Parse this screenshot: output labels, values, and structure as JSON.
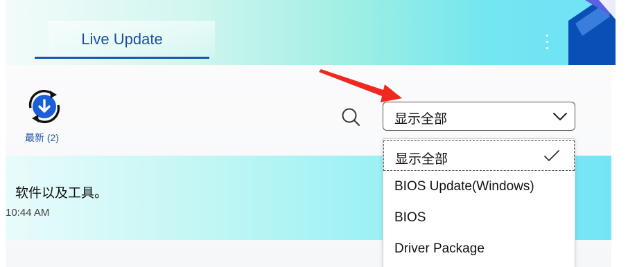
{
  "header": {
    "tab_label": "Live Update",
    "menu_icon": "more-vertical-icon",
    "accent_color": "#1456b8"
  },
  "toolbar": {
    "latest_label": "最新 (2)",
    "latest_icon": "download-refresh-icon",
    "search_icon": "search-icon"
  },
  "filter": {
    "selected": "显示全部",
    "options": [
      {
        "label": "显示全部",
        "selected": true
      },
      {
        "label": "BIOS Update(Windows)",
        "selected": false
      },
      {
        "label": "BIOS",
        "selected": false
      },
      {
        "label": "Driver Package",
        "selected": false
      }
    ]
  },
  "card": {
    "text": "软件以及工具。",
    "time": "10:44 AM"
  },
  "annotation": {
    "arrow_color": "#f0281e"
  }
}
